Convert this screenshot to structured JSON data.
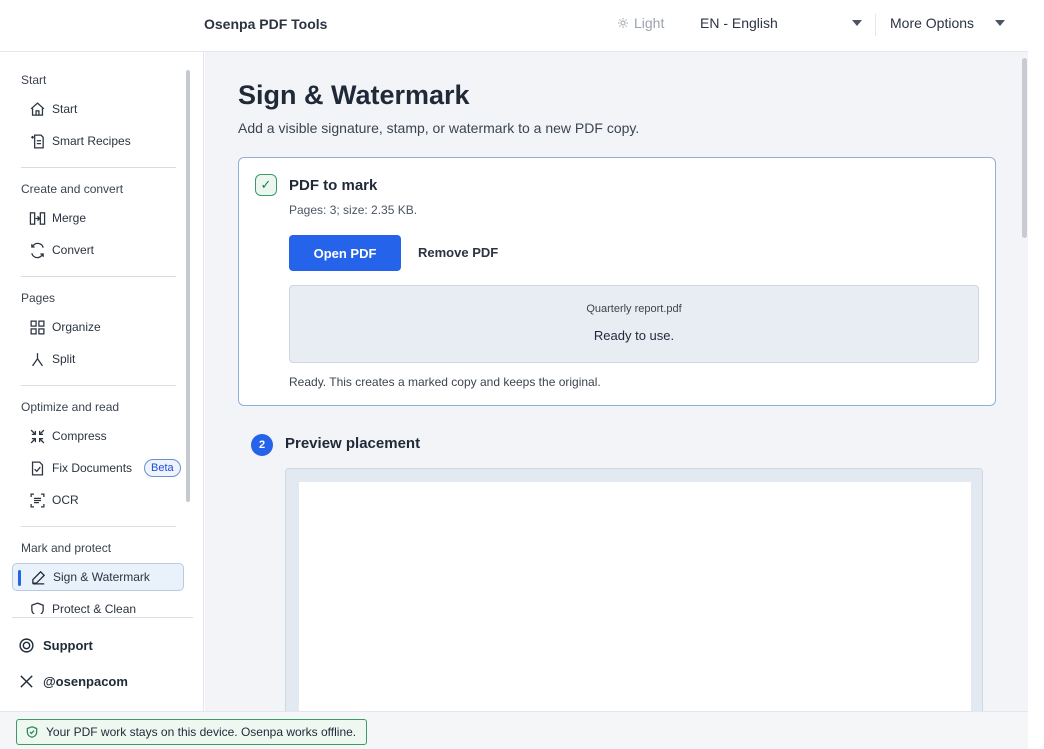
{
  "header": {
    "brand": "Osenpa PDF Tools",
    "theme_label": "Light",
    "language": "EN - English",
    "more_options": "More Options"
  },
  "sidebar": {
    "sections": [
      {
        "title": "Start",
        "items": [
          {
            "label": "Start",
            "icon": "home-icon"
          },
          {
            "label": "Smart Recipes",
            "icon": "recipe-icon"
          }
        ]
      },
      {
        "title": "Create and convert",
        "items": [
          {
            "label": "Merge",
            "icon": "merge-icon"
          },
          {
            "label": "Convert",
            "icon": "convert-icon"
          }
        ]
      },
      {
        "title": "Pages",
        "items": [
          {
            "label": "Organize",
            "icon": "organize-icon"
          },
          {
            "label": "Split",
            "icon": "split-icon"
          }
        ]
      },
      {
        "title": "Optimize and read",
        "items": [
          {
            "label": "Compress",
            "icon": "compress-icon"
          },
          {
            "label": "Fix Documents",
            "icon": "fix-icon",
            "badge": "Beta"
          },
          {
            "label": "OCR",
            "icon": "ocr-icon"
          }
        ]
      },
      {
        "title": "Mark and protect",
        "items": [
          {
            "label": "Sign & Watermark",
            "icon": "pen-icon",
            "active": true
          },
          {
            "label": "Protect & Clean",
            "icon": "shield-icon"
          }
        ]
      }
    ],
    "support_label": "Support",
    "social_label": "@osenpacom"
  },
  "main": {
    "title": "Sign & Watermark",
    "subtitle": "Add a visible signature, stamp, or watermark to a new PDF copy.",
    "step1": {
      "check": "✓",
      "title": "PDF to mark",
      "meta": "Pages: 3; size: 2.35 KB.",
      "open_button": "Open PDF",
      "remove_button": "Remove PDF",
      "file_name": "Quarterly report.pdf",
      "file_status": "Ready to use.",
      "footnote": "Ready. This creates a marked copy and keeps the original."
    },
    "step2": {
      "number": "2",
      "title": "Preview placement"
    }
  },
  "footer": {
    "offline_notice": "Your PDF work stays on this device. Osenpa works offline."
  },
  "colors": {
    "accent": "#2563eb",
    "success": "#3a9a6a",
    "card_border": "#8fb0d8"
  }
}
